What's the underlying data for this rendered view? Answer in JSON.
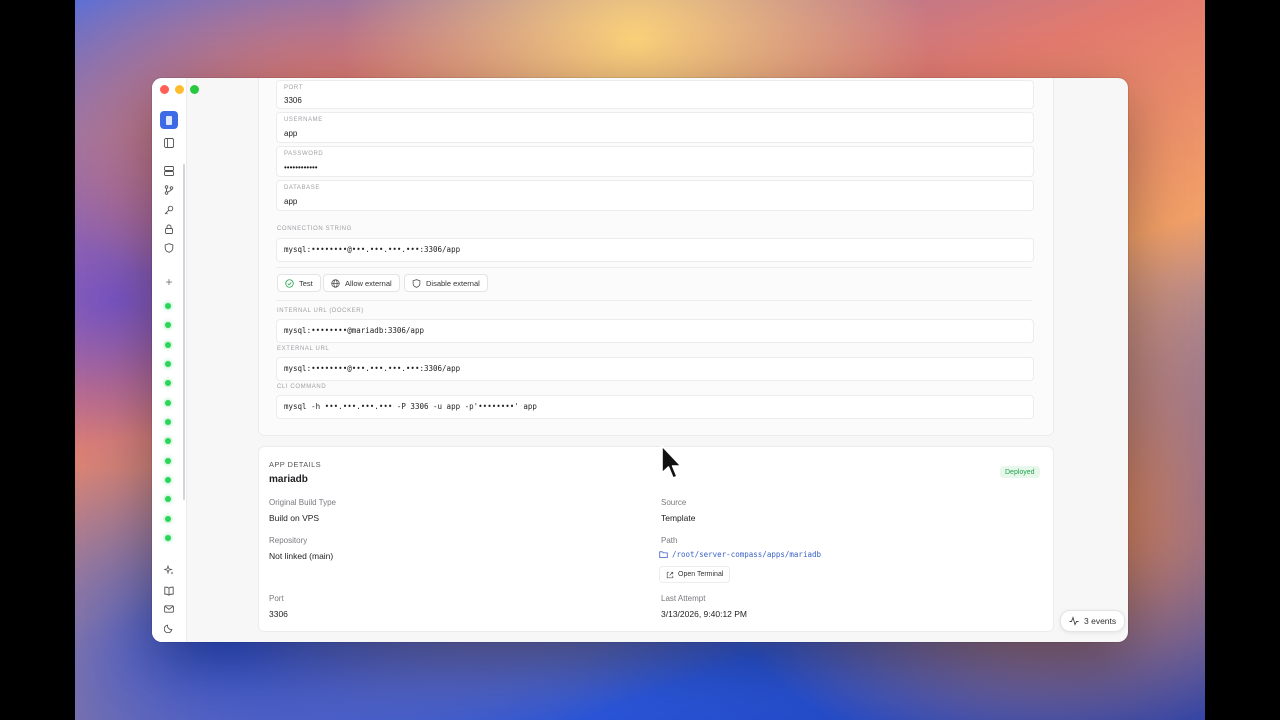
{
  "db_fields": [
    {
      "label": "PORT",
      "value": "3306"
    },
    {
      "label": "USERNAME",
      "value": "app"
    },
    {
      "label": "PASSWORD",
      "value": "••••••••••••"
    },
    {
      "label": "DATABASE",
      "value": "app"
    }
  ],
  "connection_string": {
    "label": "CONNECTION STRING",
    "value": "mysql:••••••••@•••.•••.•••.•••:3306/app"
  },
  "actions": {
    "test": "Test",
    "allow_external": "Allow external",
    "disable_external": "Disable external"
  },
  "internal_url": {
    "label": "INTERNAL URL (DOCKER)",
    "value": "mysql:••••••••@mariadb:3306/app"
  },
  "external_url": {
    "label": "EXTERNAL URL",
    "value": "mysql:••••••••@•••.•••.•••.•••:3306/app"
  },
  "cli_command": {
    "label": "CLI COMMAND",
    "value": "mysql -h •••.•••.•••.••• -P 3306 -u app -p'••••••••' app"
  },
  "app_details": {
    "heading": "APP DETAILS",
    "name": "mariadb",
    "status": "Deployed",
    "build_type_label": "Original Build Type",
    "build_type": "Build on VPS",
    "source_label": "Source",
    "source": "Template",
    "repository_label": "Repository",
    "repository": "Not linked (main)",
    "path_label": "Path",
    "path": "/root/server-compass/apps/mariadb",
    "open_terminal": "Open Terminal",
    "port_label": "Port",
    "port": "3306",
    "last_attempt_label": "Last Attempt",
    "last_attempt": "3/13/2026, 9:40:12 PM"
  },
  "events": {
    "label": "3 events",
    "close": "×"
  },
  "sidebar": {
    "add": "+",
    "status_dots": 13
  },
  "colors": {
    "accent": "#3d6be6",
    "status_ok": "#2bd45a",
    "deployed_bg": "#e7f7ec",
    "deployed_fg": "#23a24d",
    "link": "#3a62c4"
  }
}
